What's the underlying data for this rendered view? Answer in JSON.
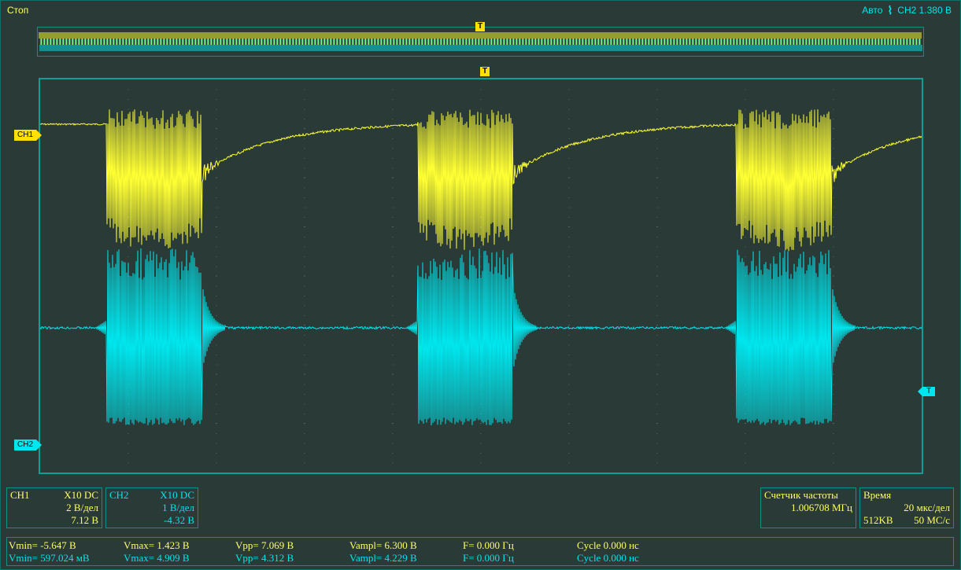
{
  "status": "Стоп",
  "trigger": {
    "mode": "Авто",
    "icon": "trigger-edge-icon",
    "source_level": "CH2  1.380 В",
    "marker_label": "T",
    "level_marker_label": "T"
  },
  "markers": {
    "ch1": "CH1",
    "ch2": "CH2"
  },
  "ch1": {
    "name": "CH1",
    "probe": "X10  DC",
    "scale": "2 В/дел",
    "offset": "7.12 В",
    "color": "#ffff33"
  },
  "ch2": {
    "name": "CH2",
    "probe": "X10  DC",
    "scale": "1 В/дел",
    "offset": "-4.32 В",
    "color": "#00e6ee"
  },
  "freq_counter": {
    "label": "Счетчик частоты",
    "value": "1.006708 МГц"
  },
  "timebase": {
    "label": "Время",
    "scale": "20 мкс/дел",
    "memory": "512KB",
    "rate": "50 МС/с"
  },
  "measurements": {
    "ch1": {
      "vmin": "Vmin= -5.647 В",
      "vmax": "Vmax= 1.423 В",
      "vpp": "Vpp= 7.069 В",
      "vampl": "Vampl= 6.300 В",
      "freq": "F= 0.000 Гц",
      "cycle": "Cycle 0.000 нс"
    },
    "ch2": {
      "vmin": "Vmin= 597.024 мВ",
      "vmax": "Vmax= 4.909 В",
      "vpp": "Vpp= 4.312 В",
      "vampl": "Vampl= 4.229 В",
      "freq": "F= 0.000 Гц",
      "cycle": "Cycle 0.000 нс"
    }
  }
}
